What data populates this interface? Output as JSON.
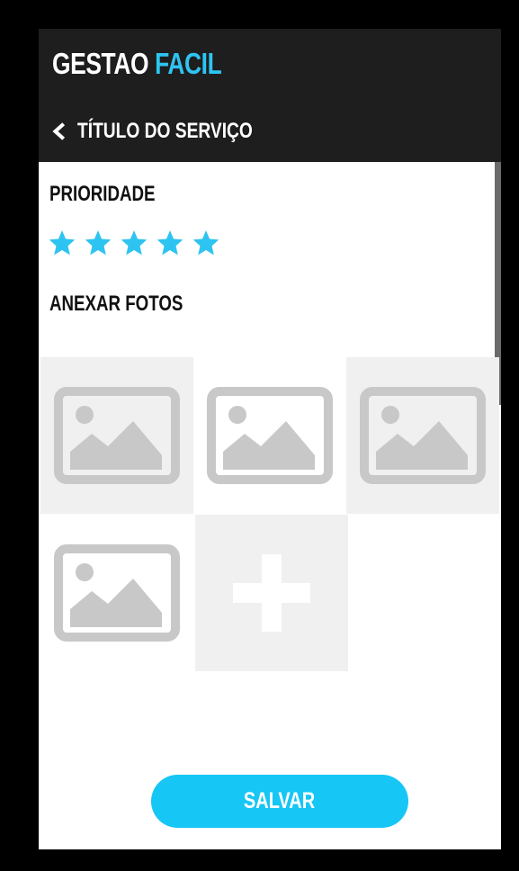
{
  "header": {
    "app_title_primary": "GESTAO",
    "app_title_accent": "FACIL",
    "back_icon": "chevron-left-icon",
    "service_title": "TÍTULO DO SERVIÇO"
  },
  "priority": {
    "label": "PRIORIDADE",
    "rating": 5,
    "max": 5,
    "star_icon": "star-icon"
  },
  "photos": {
    "label": "ANEXAR FOTOS",
    "items": [
      {
        "icon": "image-placeholder-icon"
      },
      {
        "icon": "image-placeholder-icon"
      },
      {
        "icon": "image-placeholder-icon"
      },
      {
        "icon": "image-placeholder-icon"
      }
    ],
    "add_icon": "plus-icon"
  },
  "actions": {
    "save_label": "SALVAR"
  },
  "colors": {
    "accent": "#2ec4f1",
    "button": "#16c6f5",
    "header_bg": "#1e1e1e",
    "tile_bg": "#f0f0f0",
    "placeholder_gray": "#c8c8c8"
  }
}
